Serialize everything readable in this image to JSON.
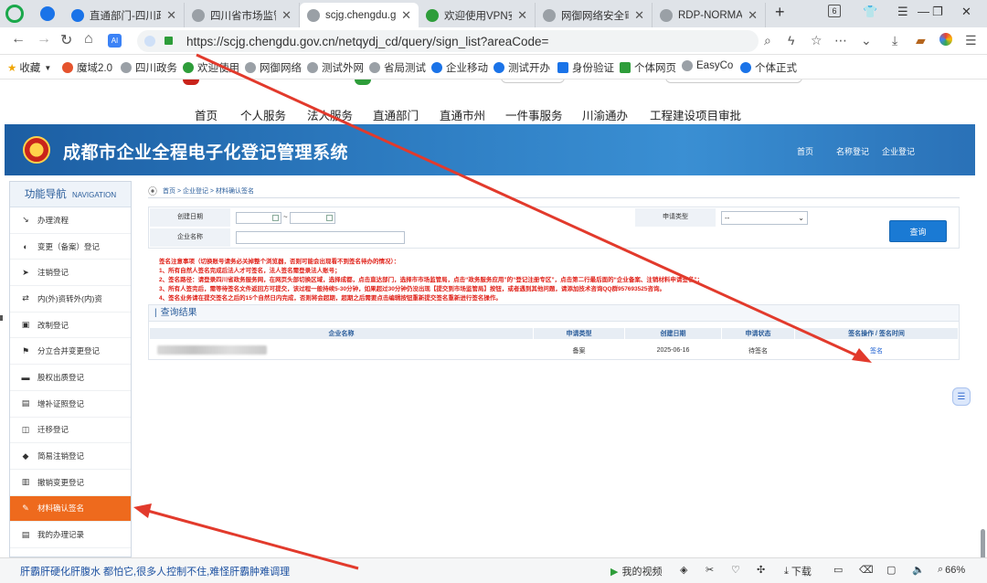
{
  "browser": {
    "tabs": [
      {
        "label": "直通部门-四川政",
        "color": "#1a73e8",
        "active": false
      },
      {
        "label": "四川省市场监管",
        "color": "#888888",
        "active": false
      },
      {
        "label": "scjg.chengdu.g",
        "color": "#888888",
        "active": true
      },
      {
        "label": "欢迎使用VPN安",
        "color": "#2e9d3a",
        "active": false
      },
      {
        "label": "网御网络安全审",
        "color": "#888888",
        "active": false
      },
      {
        "label": "RDP-NORMAL-",
        "color": "#888888",
        "active": false
      }
    ],
    "tab_count": "6",
    "url": "https://scjg.chengdu.gov.cn/netqydj_cd/query/sign_list?areaCode=",
    "bookmarks": [
      "收藏",
      "魔域2.0",
      "四川政务",
      "欢迎使用",
      "网御网络",
      "测试外网",
      "省局测试",
      "企业移动",
      "测试开办",
      "身份验证",
      "个体网页",
      "EasyCo",
      "个体正式"
    ]
  },
  "portal_nav": [
    "首页",
    "个人服务",
    "法人服务",
    "直通部门",
    "直通市州",
    "一件事服务",
    "川渝通办",
    "工程建设项目审批"
  ],
  "header": {
    "system_name": "成都市企业全程电子化登记管理系统",
    "links": [
      "首页",
      "名称登记",
      "企业登记"
    ]
  },
  "sidebar": {
    "title": "功能导航",
    "title_en": "NAVIGATION",
    "items": [
      {
        "label": "办理流程",
        "icon": "↘"
      },
      {
        "label": "变更（备案）登记",
        "icon": "◐"
      },
      {
        "label": "注销登记",
        "icon": "➤"
      },
      {
        "label": "内(外)资转外(内)资",
        "icon": "⇄"
      },
      {
        "label": "改制登记",
        "icon": "▣"
      },
      {
        "label": "分立合并变更登记",
        "icon": "⚑"
      },
      {
        "label": "股权出质登记",
        "icon": "▬"
      },
      {
        "label": "增补证照登记",
        "icon": "▤"
      },
      {
        "label": "迁移登记",
        "icon": "◫"
      },
      {
        "label": "简易注销登记",
        "icon": "◆"
      },
      {
        "label": "撤销变更登记",
        "icon": "▥"
      },
      {
        "label": "材料确认签名",
        "icon": "✎",
        "active": true
      },
      {
        "label": "我的办理记录",
        "icon": "▤"
      }
    ]
  },
  "breadcrumb": "首页 > 企业登记 > 材料确认签名",
  "search": {
    "created_date_label": "创建日期",
    "company_name_label": "企业名称",
    "apply_type_label": "申请类型",
    "apply_type_value": "--",
    "query_button": "查询"
  },
  "notice": [
    "签名注意事项（切换账号请务必关掉整个浏览器，否则可能会出现看不到签名待办的情况）：",
    "1、所有自然人签名完成后法人才可签名，法人签名需登录法人账号；",
    "2、签名路径：请登录四川省政务服务网，在网页头部切换区域，选择成都，点击直达部门，选择市市场监管局，点击“政务服务应用”的“登记注册专区”，点击第二行最后面的“企业备案、注销材料申请签名”；",
    "3、所有人签完后，需等待签名文件返回方可提交，该过程一般持续5-30分钟，如果超过30分钟仍没出现【提交到市场监管局】按钮，或者遇到其他问题，请添加技术咨询QQ群957693525咨询。",
    "4、签名业务请在提交签名之后的15个自然日内完成，否则将会超期，超期之后需要点击编辑按钮重新提交签名重新进行签名操作。"
  ],
  "results": {
    "title": "查询结果",
    "columns": [
      "企业名称",
      "申请类型",
      "创建日期",
      "申请状态",
      "签名操作 / 签名时间"
    ],
    "rows": [
      {
        "company": "",
        "type": "备案",
        "date": "2025-06-16",
        "status": "待签名",
        "action": "签名"
      }
    ]
  },
  "status_bar": {
    "news": "肝霸肝硬化肝腹水 都怕它,很多人控制不住,难怪肝霸肿难调理",
    "video": "我的视频",
    "download": "下载",
    "zoom": "66%"
  },
  "colors": {
    "banner": "#2a71b7",
    "active_nav": "#ee6a1d",
    "notice": "#e0221a",
    "arrow": "#e23a2c"
  }
}
